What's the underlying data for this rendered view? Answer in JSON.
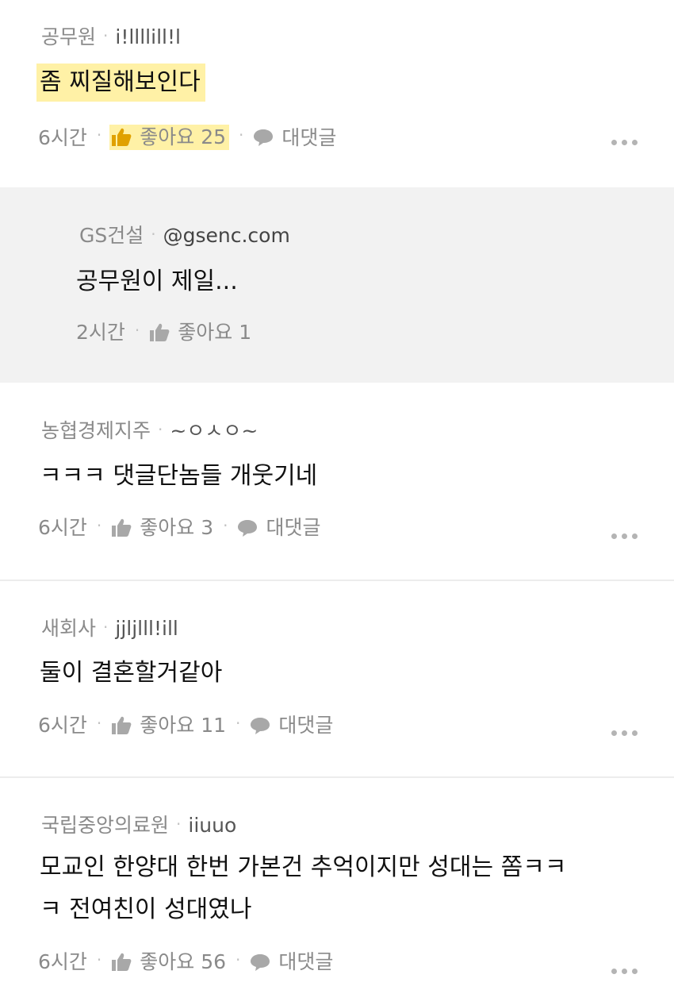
{
  "comments": [
    {
      "author": "공무원",
      "handle": "i!llllill!l",
      "text": "좀 찌질해보인다",
      "time": "6시간",
      "likes_label": "좋아요 25",
      "reply_label": "대댓글"
    },
    {
      "author": "GS건설",
      "handle": "@gsenc.com",
      "text": "공무원이 제일...",
      "time": "2시간",
      "likes_label": "좋아요 1"
    },
    {
      "author": "농협경제지주",
      "handle": "~ㅇㅅㅇ~",
      "text": "ㅋㅋㅋ 댓글단놈들 개웃기네",
      "time": "6시간",
      "likes_label": "좋아요 3",
      "reply_label": "대댓글"
    },
    {
      "author": "새회사",
      "handle": "jjljlll!ill",
      "text": "둘이 결혼할거같아",
      "time": "6시간",
      "likes_label": "좋아요 11",
      "reply_label": "대댓글"
    },
    {
      "author": "국립중앙의료원",
      "handle": "iiuuo",
      "text_line1": "모교인 한양대 한번 가본건 추억이지만 성대는 쫌ㅋㅋ",
      "text_line2": "ㅋ 전여친이 성대였나",
      "time": "6시간",
      "likes_label": "좋아요 56",
      "reply_label": "대댓글"
    }
  ],
  "separator": "·",
  "colors": {
    "highlight": "#fff1a6",
    "reply_bg": "#f2f2f2",
    "liked_icon": "#e0a100",
    "icon_gray": "#a8a8a8"
  },
  "icons": {
    "like": "thumbs-up-icon",
    "reply": "speech-bubble-icon",
    "more": "more-dots-icon"
  }
}
